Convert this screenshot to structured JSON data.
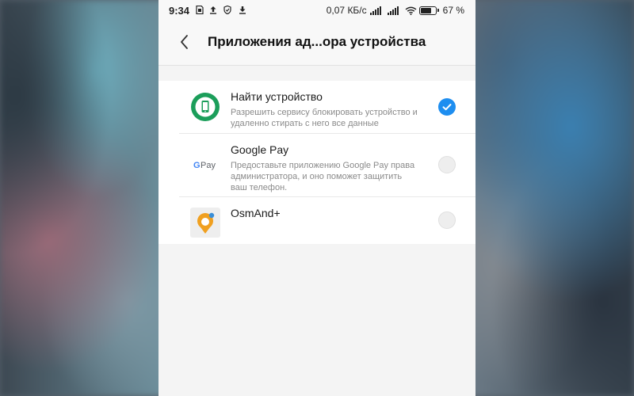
{
  "status_bar": {
    "time": "9:34",
    "network_speed": "0,07 КБ/с",
    "battery_percent": "67 %",
    "battery_level": 0.67,
    "left_icons": [
      "sim-icon",
      "upload-icon",
      "shield-icon",
      "download-icon"
    ],
    "right_icons": [
      "signal-icon",
      "signal-icon",
      "wifi-icon",
      "battery-icon"
    ]
  },
  "header": {
    "title": "Приложения ад...ора устройства",
    "back_icon": "back-arrow-icon"
  },
  "apps": [
    {
      "name": "Найти устройство",
      "description": "Разрешить сервису блокировать устройство и удаленно стирать с него все данные",
      "icon": "find-device-icon",
      "enabled": true
    },
    {
      "name": "Google Pay",
      "description": "Предоставьте приложению Google Pay права администратора, и оно поможет защитить ваш телефон.",
      "icon": "google-pay-icon",
      "icon_text": "G Pay",
      "enabled": false
    },
    {
      "name": "OsmAnd+",
      "description": "",
      "icon": "osmand-icon",
      "enabled": false
    }
  ],
  "colors": {
    "accent": "#1e8ef0",
    "find_device_green": "#1b9e5a",
    "osmand_orange": "#f0a020",
    "background": "#f4f4f4"
  }
}
